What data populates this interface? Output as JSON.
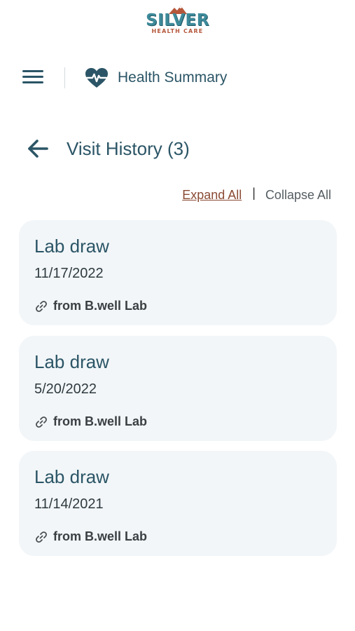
{
  "brand": {
    "name": "SILVER",
    "tagline": "HEALTH CARE",
    "colors": {
      "primary": "#2b5566",
      "accent": "#b5573b",
      "card_bg": "#f2f6f8"
    }
  },
  "nav": {
    "menu_icon": "hamburger-menu-icon",
    "section_icon": "heart-pulse-icon",
    "section_label": "Health Summary"
  },
  "page": {
    "back_icon": "arrow-left-icon",
    "title": "Visit History (3)"
  },
  "controls": {
    "expand_all": "Expand All",
    "separator": "|",
    "collapse_all": "Collapse All"
  },
  "visits": [
    {
      "title": "Lab draw",
      "date": "11/17/2022",
      "source": "from B.well Lab",
      "icon": "link-icon"
    },
    {
      "title": "Lab draw",
      "date": "5/20/2022",
      "source": "from B.well Lab",
      "icon": "link-icon"
    },
    {
      "title": "Lab draw",
      "date": "11/14/2021",
      "source": "from B.well Lab",
      "icon": "link-icon"
    }
  ]
}
